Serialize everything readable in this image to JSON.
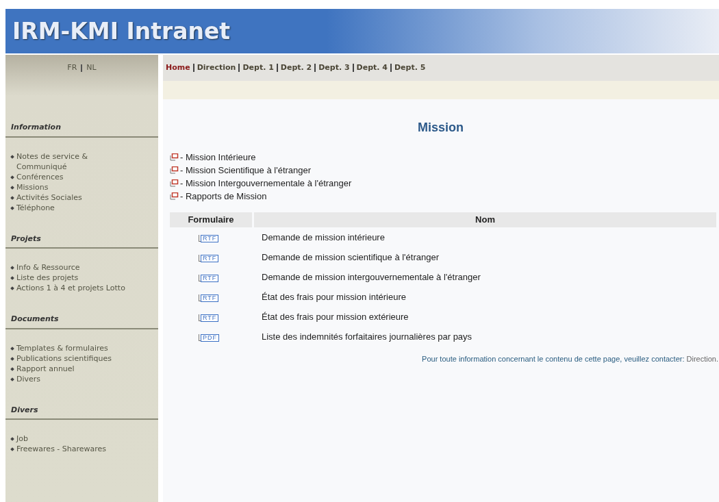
{
  "header": {
    "title": "IRM-KMI Intranet"
  },
  "languages": [
    "FR",
    "NL"
  ],
  "nav": [
    {
      "label": "Home",
      "selected": true
    },
    {
      "label": "Direction",
      "selected": false
    },
    {
      "label": "Dept. 1",
      "selected": false
    },
    {
      "label": "Dept. 2",
      "selected": false
    },
    {
      "label": "Dept. 3",
      "selected": false
    },
    {
      "label": "Dept. 4",
      "selected": false
    },
    {
      "label": "Dept. 5",
      "selected": false
    }
  ],
  "sidebar": [
    {
      "heading": "Information",
      "items": [
        "Notes de service & Communiqué",
        "Conférences",
        "Missions",
        "Activités Sociales",
        "Téléphone"
      ]
    },
    {
      "heading": "Projets",
      "items": [
        "Info & Ressource",
        "Liste des projets",
        "Actions 1 à 4 et projets Lotto"
      ]
    },
    {
      "heading": "Documents",
      "items": [
        "Templates & formulaires",
        "Publications scientifiques",
        "Rapport annuel",
        "Divers"
      ]
    },
    {
      "heading": "Divers",
      "items": [
        "Job",
        "Freewares - Sharewares"
      ]
    }
  ],
  "page_title": "Mission",
  "links": [
    "- Mission Intérieure",
    "- Mission Scientifique à l'étranger",
    "- Mission Intergouvernementale à  l'étranger",
    "- Rapports de Mission"
  ],
  "table": {
    "columns": [
      "Formulaire",
      "Nom"
    ],
    "rows": [
      {
        "format": "RTF",
        "name": "Demande de mission intérieure"
      },
      {
        "format": "RTF",
        "name": "Demande de mission scientifique à l'étranger"
      },
      {
        "format": "RTF",
        "name": "Demande de mission intergouvernementale à l'étranger"
      },
      {
        "format": "RTF",
        "name": "État des frais pour mission intérieure"
      },
      {
        "format": "RTF",
        "name": "État des frais pour mission extérieure"
      },
      {
        "format": "PDF",
        "name": "Liste des indemnités forfaitaires journalières par pays"
      }
    ]
  },
  "footer": {
    "text": "Pour toute information concernant le contenu de cette page, veuillez contacter:",
    "link": "Direction."
  }
}
